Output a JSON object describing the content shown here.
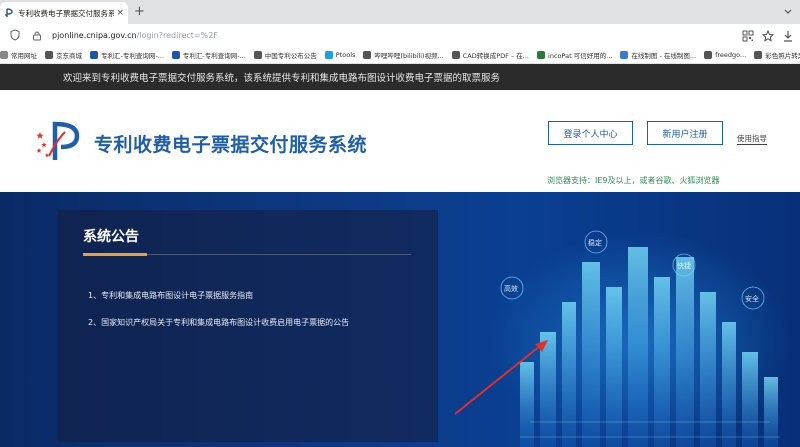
{
  "browser": {
    "tab_title": "专利收费电子票据交付服务系统",
    "tab_close": "×",
    "new_tab": "+",
    "url_host": "pjonline.cnipa.gov.cn",
    "url_path": "/login?redirect=%2F"
  },
  "bookmarks": [
    {
      "label": "常用网址",
      "color": "#888888"
    },
    {
      "label": "京东商城",
      "color": "#555555"
    },
    {
      "label": "专利汇-专利查询网-...",
      "color": "#1a56b0"
    },
    {
      "label": "专利汇-专利查询网-...",
      "color": "#1a56b0"
    },
    {
      "label": "中国专利公布公告",
      "color": "#555555"
    },
    {
      "label": "Ptools",
      "color": "#1aa1e0"
    },
    {
      "label": "哔哩哔哩(bilibili)视频...",
      "color": "#555555"
    },
    {
      "label": "CAD转换成PDF – 在...",
      "color": "#555555"
    },
    {
      "label": "incoPat 可信好用的...",
      "color": "#2a7a3a"
    },
    {
      "label": "在线制图 - 在线制图...",
      "color": "#3a7ad0"
    },
    {
      "label": "freedgo...",
      "color": "#555555"
    },
    {
      "label": "彩色照片转黑白在线...",
      "color": "#555555"
    }
  ],
  "notice_bar": "欢迎来到专利收费电子票据交付服务系统，该系统提供专利和集成电路布图设计收费电子票据的取票服务",
  "header": {
    "site_title": "专利收费电子票据交付服务系统",
    "login_button": "登录个人中心",
    "register_button": "新用户注册",
    "guide_link": "使用指导",
    "browser_support": "浏览器支持：IE9及以上，或者谷歌、火狐浏览器"
  },
  "announcements": {
    "title": "系统公告",
    "items": [
      "1、专利和集成电路布图设计电子票据服务指南",
      "2、国家知识产权局关于专利和集成电路布图设计收费启用电子票据的公告"
    ]
  },
  "hero_tags": {
    "stable": "稳定",
    "fast": "快捷",
    "efficient": "高效",
    "secure": "安全"
  },
  "colors": {
    "brand_blue": "#1f5ea8",
    "support_green": "#2e8b57",
    "accent_orange": "#f0a030",
    "arrow_red": "#e0302a"
  }
}
